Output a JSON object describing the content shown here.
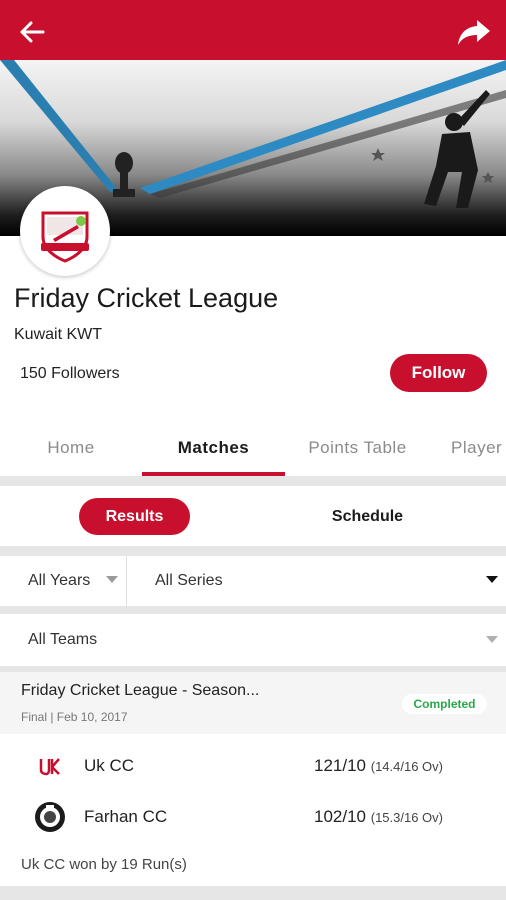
{
  "topbar": {
    "back_icon": "arrow-left-icon",
    "share_icon": "share-forward-icon",
    "color": "#c8102e"
  },
  "league": {
    "name": "Friday Cricket League",
    "location": "Kuwait KWT",
    "followers": "150 Followers",
    "follow_label": "Follow"
  },
  "tabs": [
    {
      "label": "Home",
      "active": false
    },
    {
      "label": "Matches",
      "active": true
    },
    {
      "label": "Points Table",
      "active": false
    },
    {
      "label": "Player",
      "active": false
    }
  ],
  "subtabs": {
    "results_label": "Results",
    "schedule_label": "Schedule"
  },
  "filters": {
    "years": "All Years",
    "series": "All Series",
    "teams": "All Teams"
  },
  "match": {
    "title": "Friday Cricket League - Season...",
    "meta": "Final | Feb 10, 2017",
    "status": "Completed",
    "teams": [
      {
        "name": "Uk CC",
        "score": "121/10",
        "overs": "(14.4/16 Ov)"
      },
      {
        "name": "Farhan CC",
        "score": "102/10",
        "overs": "(15.3/16 Ov)"
      }
    ],
    "result": "Uk CC won by 19 Run(s)"
  },
  "colors": {
    "accent": "#c8102e",
    "completed": "#29a84a"
  }
}
